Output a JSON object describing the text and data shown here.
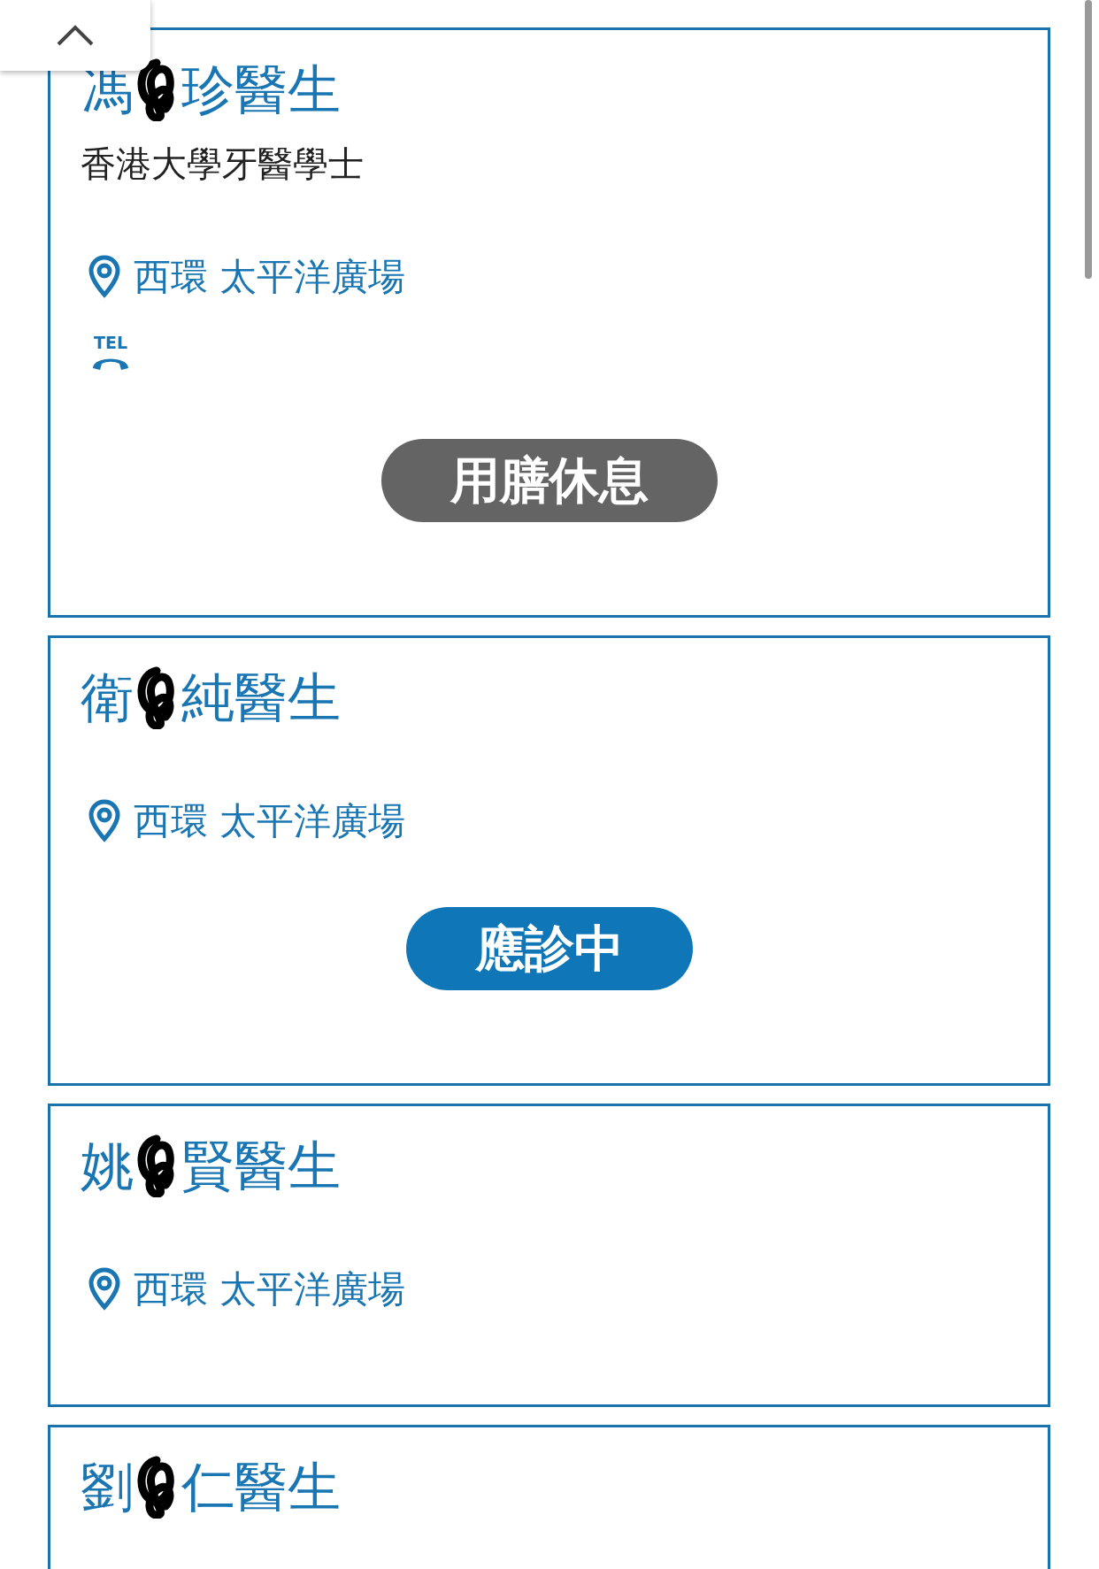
{
  "doctors": [
    {
      "name_start": "馮",
      "name_end": "珍醫生",
      "qualification": "香港大學牙醫學士",
      "location": "西環 太平洋廣場",
      "tel_label": "TEL",
      "status": {
        "kind": "break",
        "label": "用膳休息"
      }
    },
    {
      "name_start": "衛",
      "name_end": "純醫生",
      "location": "西環 太平洋廣場",
      "status": {
        "kind": "open",
        "label": "應診中"
      }
    },
    {
      "name_start": "姚",
      "name_end": "賢醫生",
      "location": "西環 太平洋廣場"
    },
    {
      "name_start": "劉",
      "name_end": "仁醫生"
    }
  ]
}
